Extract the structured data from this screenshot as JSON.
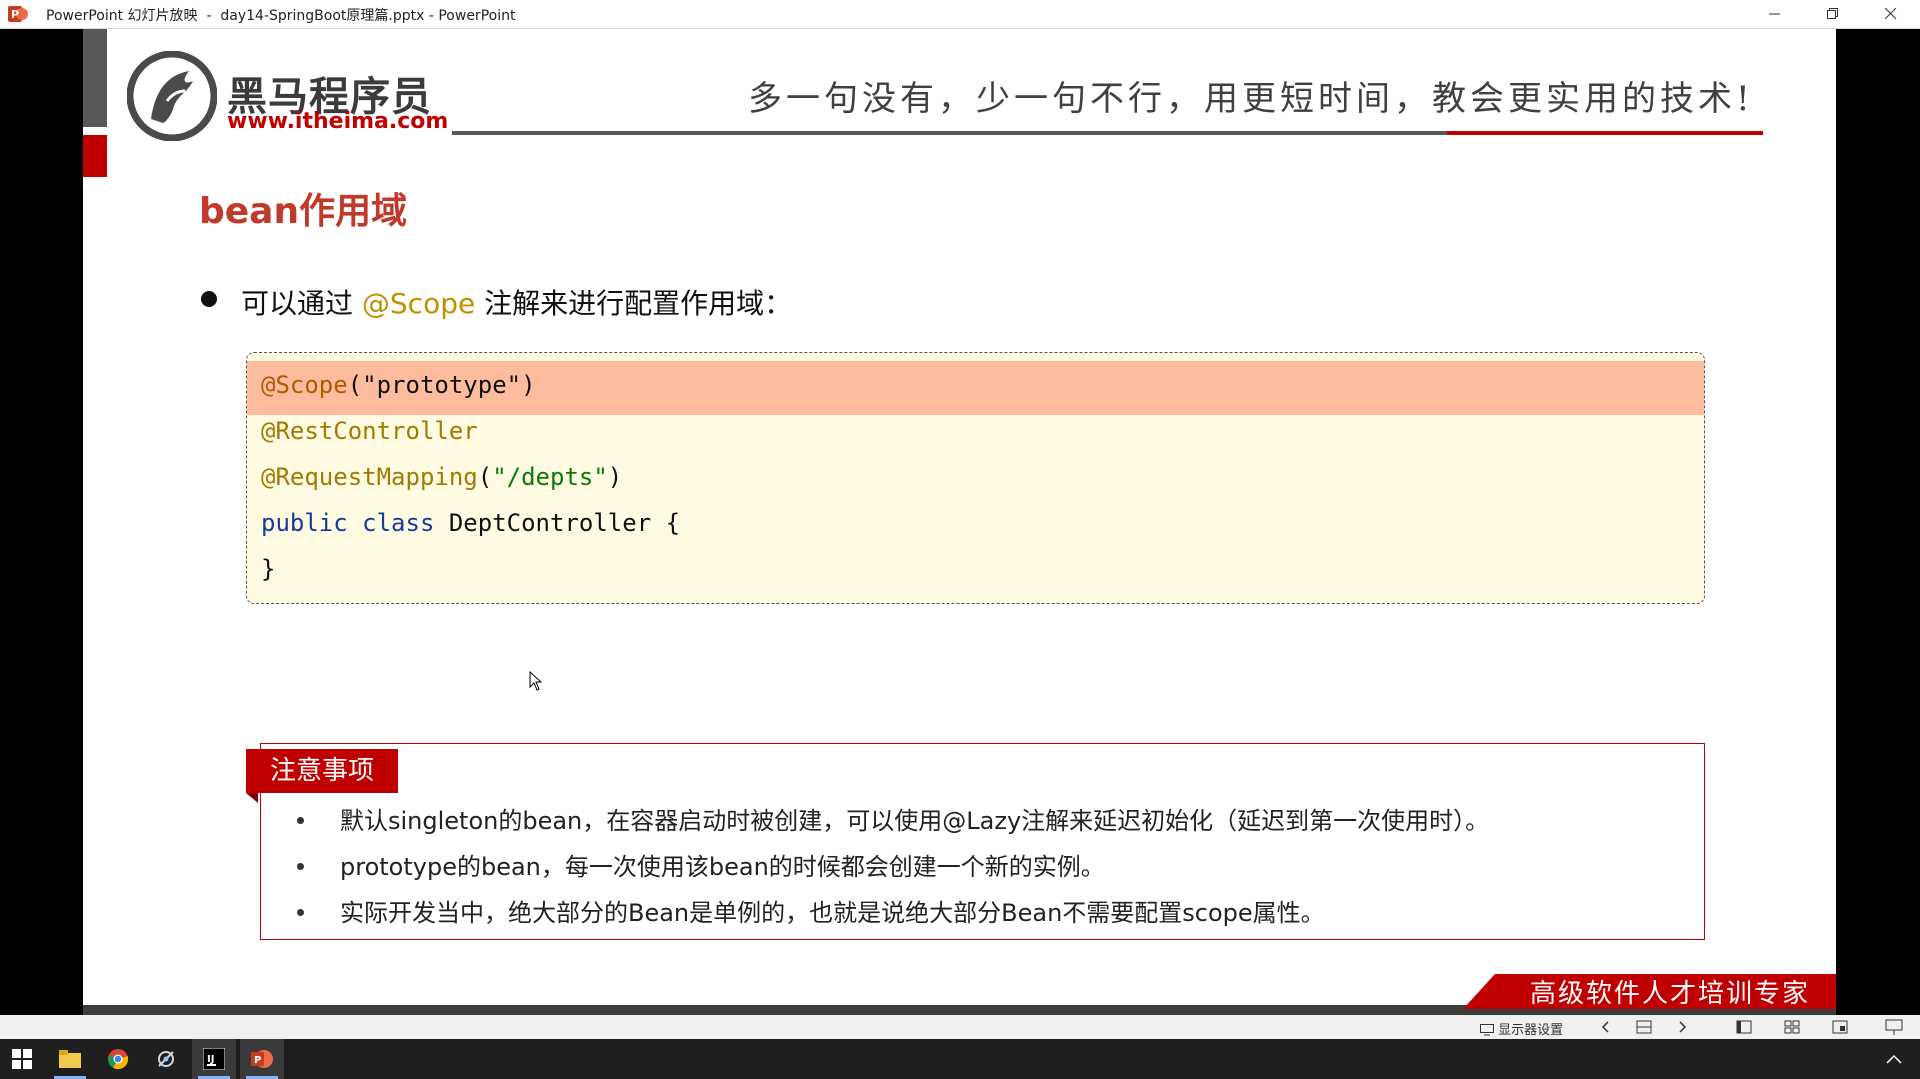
{
  "window": {
    "title": "PowerPoint 幻灯片放映  -  day14-SpringBoot原理篇.pptx - PowerPoint",
    "controls": [
      "minimize",
      "restore",
      "close"
    ]
  },
  "slide": {
    "logo": {
      "name_cn": "黑马程序员",
      "url": "www.itheima.com"
    },
    "slogan": "多一句没有，少一句不行，用更短时间，教会更实用的技术!",
    "title": "bean作用域",
    "bullet": {
      "before": "可以通过 ",
      "keyword": "@Scope",
      "after": " 注解来进行配置作用域："
    },
    "code": {
      "line1_ann": "@Scope",
      "line1_open": "(",
      "line1_str": "\"prototype\"",
      "line1_close": ")",
      "line2": "@RestController",
      "line3_ann": "@RequestMapping",
      "line3_open": "(",
      "line3_str": "\"/depts\"",
      "line3_close": ")",
      "line4_kw1": "public",
      "line4_kw2": "class",
      "line4_rest": " DeptController {",
      "line5": "}"
    },
    "notes": {
      "tag": "注意事项",
      "items": [
        "默认singleton的bean，在容器启动时被创建，可以使用@Lazy注解来延迟初始化（延迟到第一次使用时）。",
        "prototype的bean，每一次使用该bean的时候都会创建一个新的实例。",
        "实际开发当中，绝大部分的Bean是单例的，也就是说绝大部分Bean不需要配置scope属性。"
      ]
    },
    "corner_banner": "高级软件人才培训专家"
  },
  "slideshow_toolbar": {
    "monitor_settings": "显示器设置"
  },
  "taskbar": {
    "apps": [
      "start-icon",
      "file-explorer-icon",
      "chrome-icon",
      "app-icon",
      "intellij-icon",
      "powerpoint-icon"
    ]
  },
  "colors": {
    "brand_red": "#c00000",
    "code_bg": "#fffbe3",
    "code_highlight": "#fcbc9d",
    "annotation": "#bf9000"
  }
}
